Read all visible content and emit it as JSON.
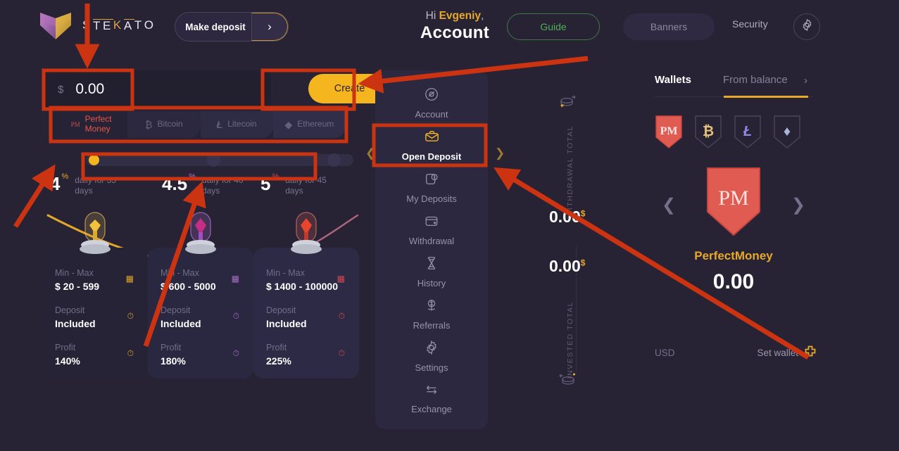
{
  "brand": {
    "name_letters": [
      "S",
      "T",
      "E",
      "K",
      "A",
      "T",
      "O"
    ],
    "name": "STEKATO",
    "logo_icon": "chevron-logo"
  },
  "header": {
    "make_deposit_label": "Make deposit",
    "make_deposit_arrow_icon": "chevron-right-icon",
    "greeting_prefix": "Hi ",
    "greeting_name": "Evgeniy",
    "greeting_suffix": ",",
    "page_title": "Account",
    "guide_label": "Guide",
    "banners_label": "Banners",
    "security_label": "Security",
    "settings_icon": "gear-icon",
    "guide_color": "#4fae57",
    "accent_gold": "#e8a92a"
  },
  "deposit_form": {
    "currency_symbol": "$",
    "amount_value": "0.00",
    "amount_placeholder": "0.00",
    "create_label": "Create",
    "create_color": "#f5b51f",
    "payment_methods": [
      {
        "id": "pm",
        "icon": "perfectmoney-icon",
        "label": "Perfect\nMoney",
        "label_line1": "Perfect",
        "label_line2": "Money",
        "active": true,
        "color": "#e4574a"
      },
      {
        "id": "btc",
        "icon": "bitcoin-icon",
        "label": "Bitcoin",
        "active": false,
        "color": "#6f6a85"
      },
      {
        "id": "ltc",
        "icon": "litecoin-icon",
        "label": "Litecoin",
        "active": false,
        "color": "#6f6a85"
      },
      {
        "id": "eth",
        "icon": "ethereum-icon",
        "label": "Ethereum",
        "active": false,
        "color": "#6f6a85"
      }
    ],
    "slider": {
      "selected_index": 0,
      "stops": 3,
      "knob_color": "#f5b51f"
    }
  },
  "plans": [
    {
      "rate": "4",
      "rate_unit": "%",
      "rate_color": "#e8a92a",
      "term": "daily for 35 days",
      "minmax_label": "Min - Max",
      "minmax_value": "$ 20 - 599",
      "deposit_label": "Deposit",
      "deposit_value": "Included",
      "profit_label": "Profit",
      "profit_value": "140%",
      "icon_color": "#e0a52a",
      "jar_icon": "gold-gem-jar-icon"
    },
    {
      "rate": "4.5",
      "rate_unit": "%",
      "rate_color": "#c06fd0",
      "term": "daily for 40 days",
      "minmax_label": "Min - Max",
      "minmax_value": "$ 600 - 5000",
      "deposit_label": "Deposit",
      "deposit_value": "Included",
      "profit_label": "Profit",
      "profit_value": "180%",
      "icon_color": "#a86ec4",
      "jar_icon": "purple-gem-jar-icon"
    },
    {
      "rate": "5",
      "rate_unit": "%",
      "rate_color": "#d1484f",
      "term": "daily for 45 days",
      "minmax_label": "Min - Max",
      "minmax_value": "$ 1400 - 100000",
      "deposit_label": "Deposit",
      "deposit_value": "Included",
      "profit_label": "Profit",
      "profit_value": "225%",
      "icon_color": "#d1484f",
      "jar_icon": "red-gem-jar-icon"
    }
  ],
  "nav": {
    "prev_icon": "chevron-left-icon",
    "next_icon": "chevron-right-icon",
    "items": [
      {
        "label": "Account",
        "icon": "account-icon",
        "active": false
      },
      {
        "label": "Open Deposit",
        "icon": "briefcase-icon",
        "active": true
      },
      {
        "label": "My Deposits",
        "icon": "deposit-bag-icon",
        "active": false
      },
      {
        "label": "Withdrawal",
        "icon": "wallet-icon",
        "active": false
      },
      {
        "label": "History",
        "icon": "hourglass-icon",
        "active": false
      },
      {
        "label": "Referrals",
        "icon": "referral-icon",
        "active": false
      },
      {
        "label": "Settings",
        "icon": "gear-icon",
        "active": false
      },
      {
        "label": "Exchange",
        "icon": "exchange-icon",
        "active": false
      }
    ]
  },
  "totals": {
    "withdrawal_label": "WITHDRAWAL TOTAL",
    "withdrawal_value": "0.00",
    "withdrawal_currency": "$",
    "invested_label": "INVESTED TOTAL",
    "invested_value": "0.00",
    "invested_currency": "$",
    "top_icon": "coins-out-icon",
    "bottom_icon": "coins-in-icon"
  },
  "wallets": {
    "tab_wallets": "Wallets",
    "tab_from_balance": "From balance",
    "tab_chevron_icon": "chevron-right-icon",
    "active_tab": "From balance",
    "underline_color": "#e8a92a",
    "chips": [
      {
        "id": "pm",
        "glyph": "PM",
        "icon": "perfectmoney-icon",
        "selected": true,
        "color": "#e05b52"
      },
      {
        "id": "btc",
        "glyph": "₿",
        "icon": "bitcoin-icon",
        "selected": false,
        "color": "#e3c07a"
      },
      {
        "id": "ltc",
        "glyph": "Ł",
        "icon": "litecoin-icon",
        "selected": false,
        "color": "#8f87e8"
      },
      {
        "id": "eth",
        "glyph": "♦",
        "icon": "ethereum-icon",
        "selected": false,
        "color": "#a8b4d8"
      }
    ],
    "selected_wallet_glyph": "PM",
    "selected_wallet_name": "PerfectMoney",
    "selected_wallet_balance": "0.00",
    "prev_icon": "chevron-left-icon",
    "next_icon": "chevron-right-icon",
    "currency_label": "USD",
    "set_wallet_label": "Set wallet",
    "set_wallet_icon": "plus-icon"
  },
  "annotations": {
    "color": "#cc3311",
    "boxes": [
      {
        "name": "amount-field-highlight"
      },
      {
        "name": "create-button-highlight"
      },
      {
        "name": "payment-methods-highlight"
      },
      {
        "name": "slider-highlight"
      },
      {
        "name": "open-deposit-highlight"
      }
    ],
    "arrows": [
      {
        "name": "arrow-down-to-amount"
      },
      {
        "name": "arrow-to-account-title"
      },
      {
        "name": "arrow-up-to-slider"
      },
      {
        "name": "arrow-up-to-rate"
      },
      {
        "name": "arrow-to-set-wallet"
      }
    ]
  }
}
